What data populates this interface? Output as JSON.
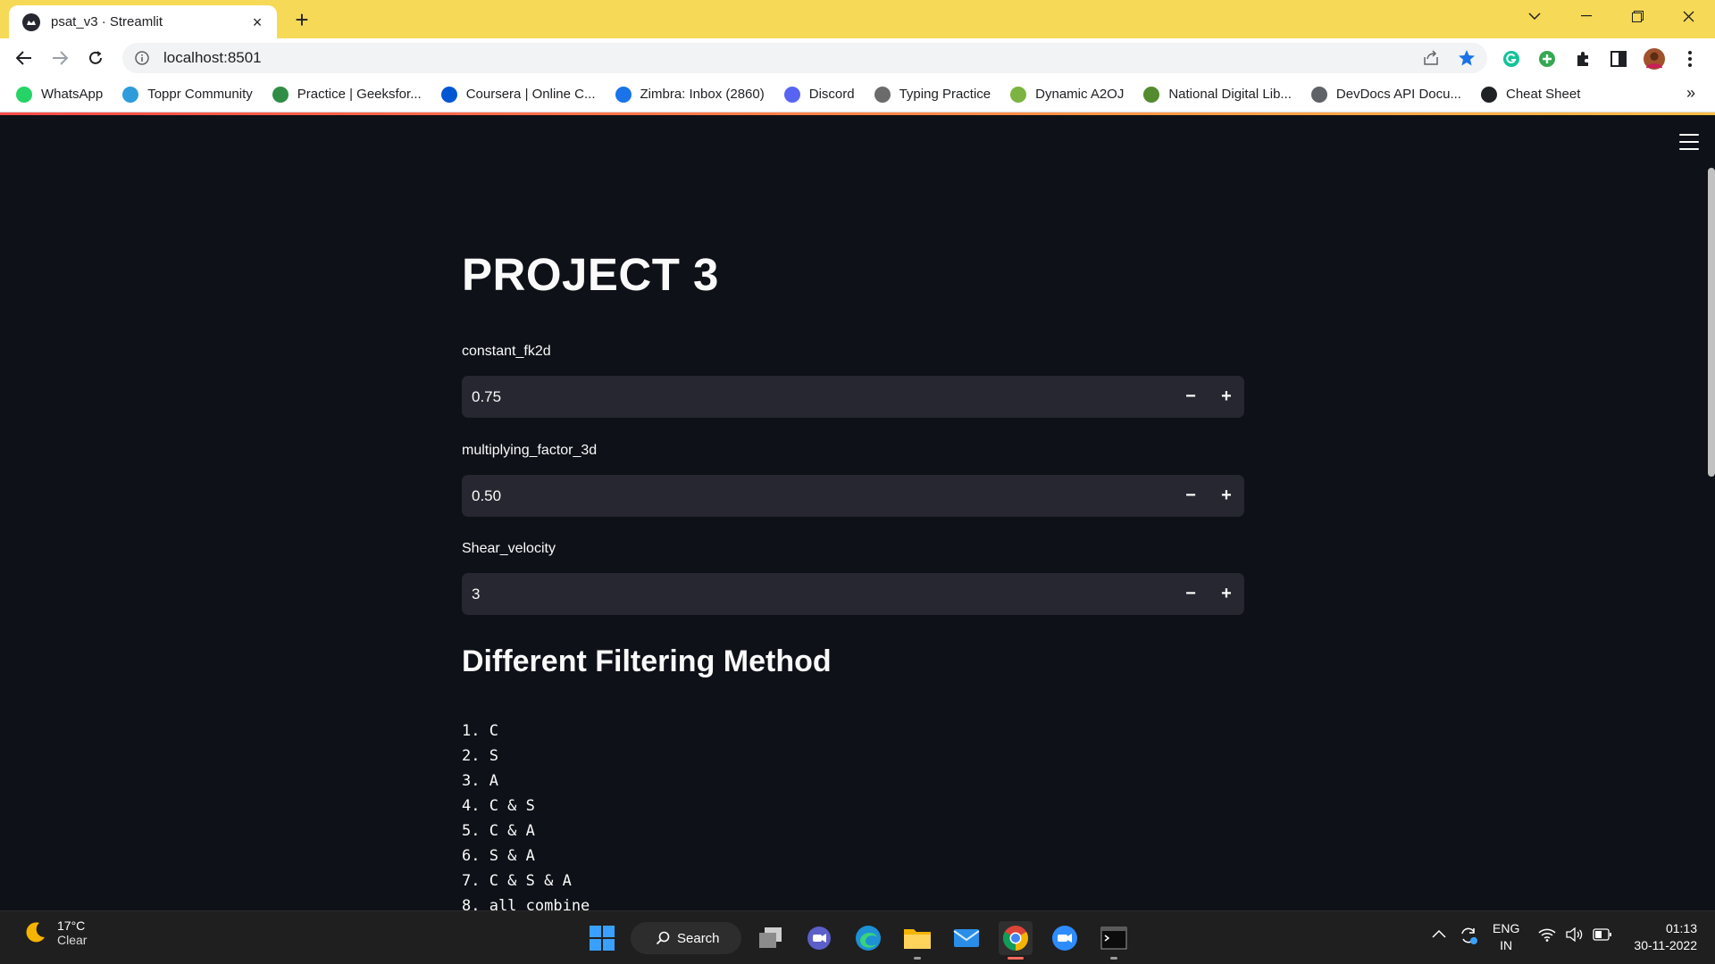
{
  "browser": {
    "tab_title": "psat_v3 · Streamlit",
    "url": "localhost:8501",
    "bookmarks": [
      {
        "label": "WhatsApp",
        "icon": "whatsapp-icon",
        "color": "#25d366"
      },
      {
        "label": "Toppr Community",
        "icon": "toppr-icon",
        "color": "#2d9cdb"
      },
      {
        "label": "Practice | Geeksfor...",
        "icon": "geeksforgeeks-icon",
        "color": "#2f8d46"
      },
      {
        "label": "Coursera | Online C...",
        "icon": "coursera-icon",
        "color": "#0056d2"
      },
      {
        "label": "Zimbra: Inbox (2860)",
        "icon": "zimbra-icon",
        "color": "#1a73e8"
      },
      {
        "label": "Discord",
        "icon": "discord-icon",
        "color": "#5865f2"
      },
      {
        "label": "Typing Practice",
        "icon": "typing-icon",
        "color": "#6b6b6b"
      },
      {
        "label": "Dynamic A2OJ",
        "icon": "a2oj-icon",
        "color": "#7cb342"
      },
      {
        "label": "National Digital Lib...",
        "icon": "ndl-icon",
        "color": "#558b2f"
      },
      {
        "label": "DevDocs API Docu...",
        "icon": "devdocs-icon",
        "color": "#5f6368"
      },
      {
        "label": "Cheat Sheet",
        "icon": "cheatsheet-icon",
        "color": "#202124"
      }
    ]
  },
  "app": {
    "title": "PROJECT 3",
    "inputs": [
      {
        "label": "constant_fk2d",
        "value": "0.75"
      },
      {
        "label": "multiplying_factor_3d",
        "value": "0.50"
      },
      {
        "label": "Shear_velocity",
        "value": "3"
      }
    ],
    "decrement_symbol": "−",
    "increment_symbol": "+",
    "section_title": "Different Filtering Method",
    "methods": [
      "1. C",
      "2. S",
      "3. A",
      "4. C & S",
      "5. C & A",
      "6. S & A",
      "7. C & S & A",
      "8. all combine"
    ]
  },
  "taskbar": {
    "temperature": "17°C",
    "condition": "Clear",
    "search_label": "Search",
    "lang_line1": "ENG",
    "lang_line2": "IN",
    "time": "01:13",
    "date": "30-11-2022"
  },
  "colors": {
    "chrome_frame": "#f6d957",
    "page_bg": "#0e1117",
    "input_bg": "#262730",
    "text": "#fafafa"
  }
}
